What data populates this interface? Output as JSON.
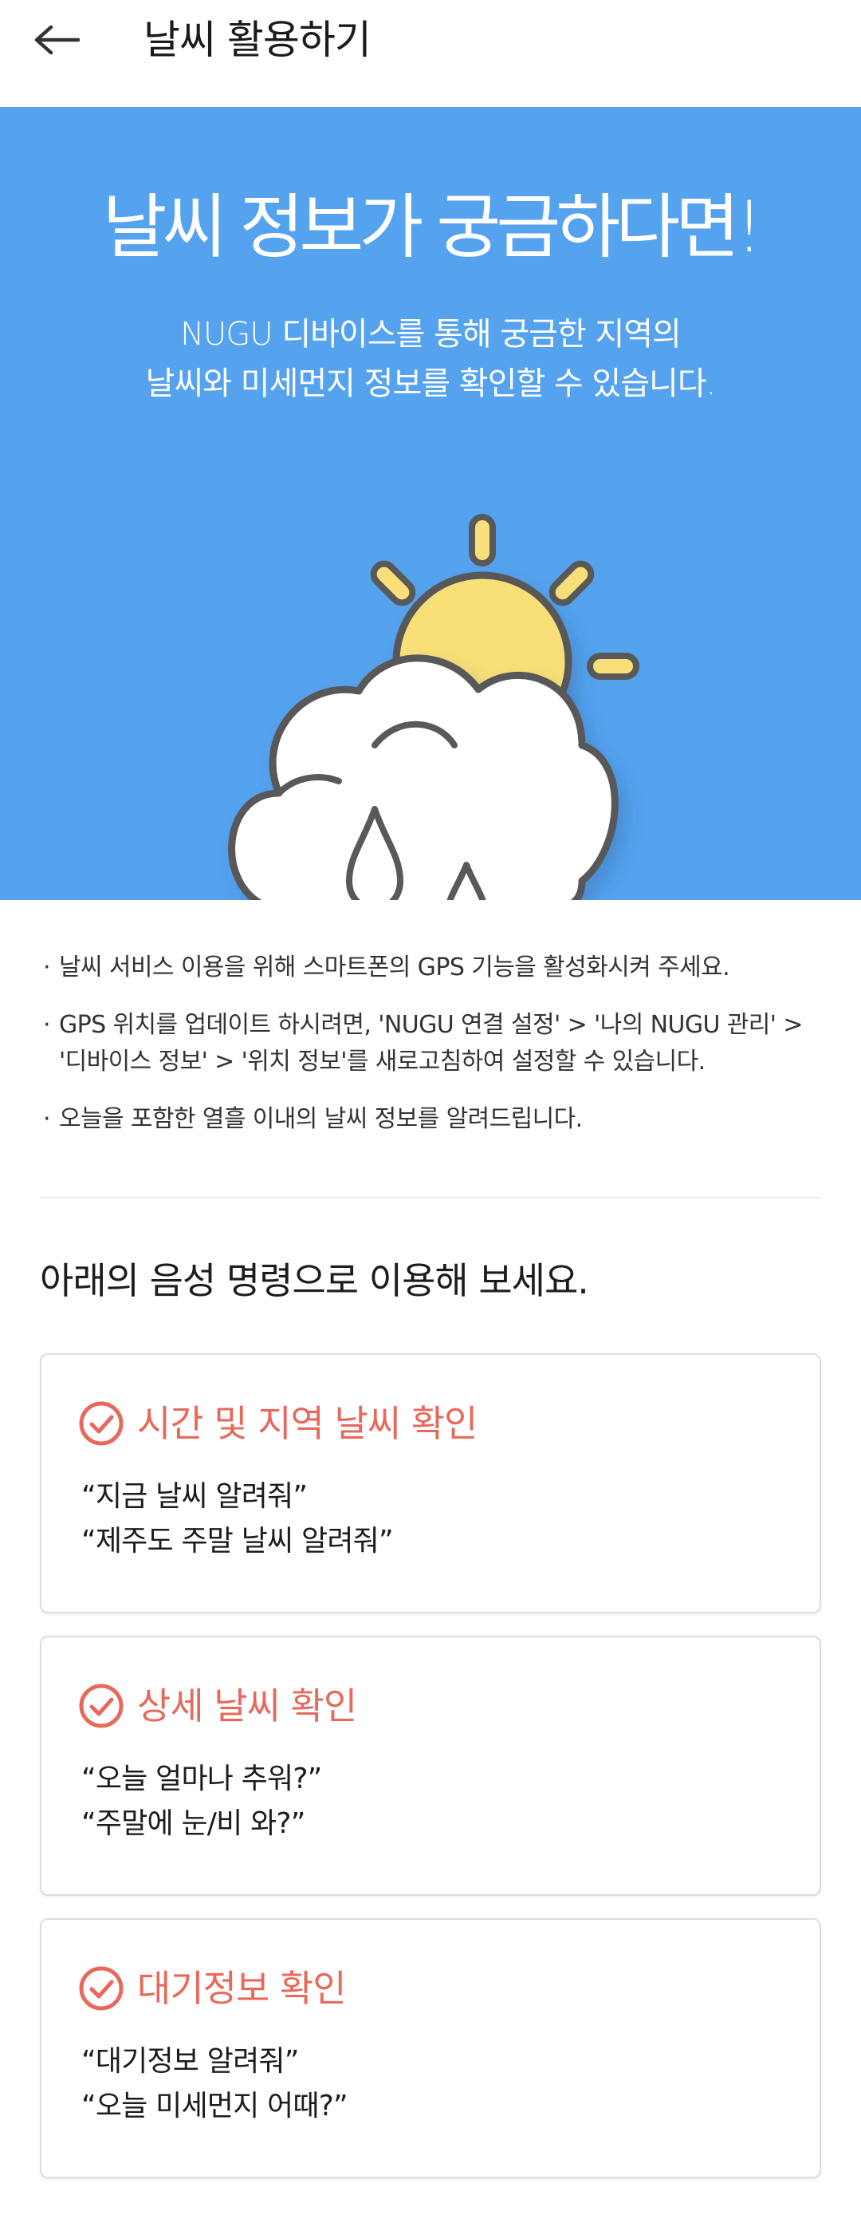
{
  "appbar": {
    "title": "날씨 활용하기",
    "back_icon": "arrow-left-icon"
  },
  "hero": {
    "title": "날씨 정보가 궁금하다면!",
    "subtitle_line1": "NUGU 디바이스를 통해 궁금한 지역의",
    "subtitle_line2": "날씨와 미세먼지 정보를 확인할 수 있습니다.",
    "illustration": "sun-cloud-rain-icon",
    "colors": {
      "background": "#55a2ee",
      "sun": "#f9df77",
      "outline": "#595959",
      "cloud": "#ffffff"
    }
  },
  "notes": [
    {
      "bullet": "·",
      "text": "날씨 서비스 이용을 위해 스마트폰의 GPS 기능을 활성화시켜 주세요."
    },
    {
      "bullet": "·",
      "text": "GPS 위치를 업데이트 하시려면, 'NUGU 연결 설정' > '나의 NUGU 관리' > '디바이스 정보' > '위치 정보'를 새로고침하여 설정할 수 있습니다."
    },
    {
      "bullet": "·",
      "text": "오늘을 포함한 열흘 이내의 날씨 정보를 알려드립니다."
    }
  ],
  "section_title": "아래의 음성 명령으로 이용해 보세요.",
  "accent_color": "#e8695c",
  "cards": [
    {
      "title": "시간 및 지역 날씨 확인",
      "icon": "check-circle-icon",
      "commands": [
        "“지금 날씨 알려줘”",
        "“제주도 주말 날씨 알려줘”"
      ]
    },
    {
      "title": "상세 날씨 확인",
      "icon": "check-circle-icon",
      "commands": [
        "“오늘 얼마나 추워?”",
        "“주말에 눈/비 와?”"
      ]
    },
    {
      "title": "대기정보 확인",
      "icon": "check-circle-icon",
      "commands": [
        "“대기정보 알려줘”",
        "“오늘 미세먼지 어때?”"
      ]
    }
  ]
}
